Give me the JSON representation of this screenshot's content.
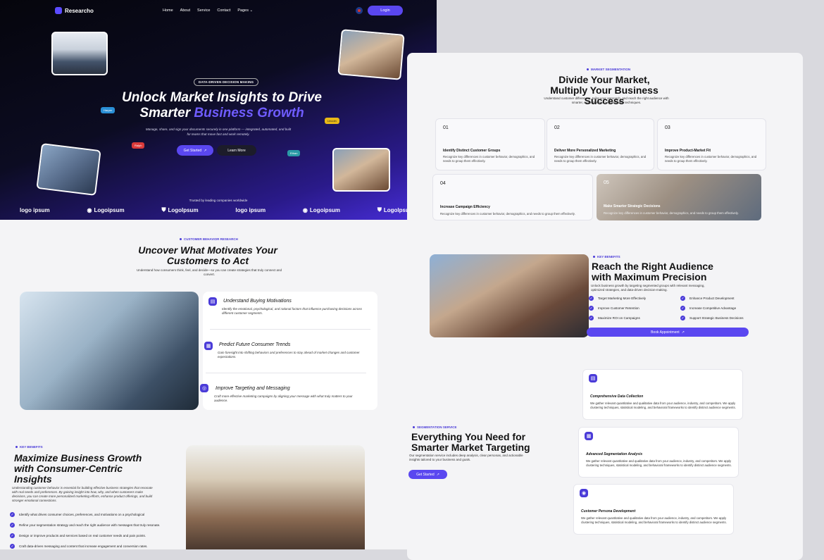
{
  "nav": {
    "brand": "Researcho",
    "links": [
      "Home",
      "About",
      "Service",
      "Contact",
      "Pages"
    ],
    "login": "Login"
  },
  "hero": {
    "pill": "DATA-DRIVEN DECISION MAKING",
    "title_line1": "Unlock Market Insights to Drive",
    "title_line2a": "Smarter ",
    "title_line2b": "Business Growth",
    "subtitle": "Manage, share, and sign your documents securely in one platform — integrated, automated, and built for teams that move fast and work remotely.",
    "btn_primary": "Get Started",
    "btn_secondary": "Learn More",
    "tags": [
      "Harper",
      "Lincoln",
      "Ralph",
      "Ethan"
    ],
    "trusted": "Trusted by leading companies worldwide",
    "logos": [
      "logo ipsum",
      "Logoipsum",
      "Logolpsum",
      "logo ipsum",
      "Logoipsum",
      "Logolpsum"
    ]
  },
  "behavior": {
    "eyebrow": "CUSTOMER BEHAVIOR RESEARCH",
    "title": "Uncover What Motivates Your Customers to Act",
    "subtitle": "Understand how consumers think, feel, and decide—so you can create strategies that truly connect and convert.",
    "items": [
      {
        "title": "Understand Buying Motivations",
        "desc": "Identify the emotional, psychological, and rational factors that influence purchasing decisions across different customer segments."
      },
      {
        "title": "Predict Future Consumer Trends",
        "desc": "Gain foresight into shifting behaviors and preferences to stay ahead of market changes and customer expectations."
      },
      {
        "title": "Improve Targeting and Messaging",
        "desc": "Craft more effective marketing campaigns by aligning your message with what truly matters to your audience."
      }
    ]
  },
  "growth": {
    "eyebrow": "KEY BENEFITS",
    "title": "Maximize Business Growth with Consumer-Centric Insights",
    "desc": "Understanding customer behavior is essential for building effective business strategies that resonate with real needs and preferences. By gaining insight into how, why, and when customers make decisions, you can create more personalized marketing efforts, enhance product offerings, and build stronger emotional connections.",
    "checks": [
      "Identify what drives consumer choices, preferences, and motivations on a psychological",
      "Refine your segmentation strategy and reach the right audience with messages that truly resonate.",
      "Design or improve products and services based on real customer needs and pain points.",
      "Craft data-driven messaging and content that increase engagement and conversion rates."
    ]
  },
  "segmentation": {
    "eyebrow": "MARKET SEGMENTATION",
    "title": "Divide Your Market, Multiply Your Business Success",
    "subtitle": "Understand customer differences, tailor your approach, and reach the right audience with smarter, more strategic segmentation techniques.",
    "cards": [
      {
        "num": "01",
        "title": "Identify Distinct Customer Groups",
        "desc": "Recognize key differences in customer behavior, demographics, and needs to group them effectively."
      },
      {
        "num": "02",
        "title": "Deliver More Personalized Marketing",
        "desc": "Recognize key differences in customer behavior, demographics, and needs to group them effectively."
      },
      {
        "num": "03",
        "title": "Improve Product-Market Fit",
        "desc": "Recognize key differences in customer behavior, demographics, and needs to group them effectively."
      },
      {
        "num": "04",
        "title": "Increase Campaign Efficiency",
        "desc": "Recognize key differences in customer behavior, demographics, and needs to group them effectively."
      },
      {
        "num": "05",
        "title": "Make Smarter Strategic Decisions",
        "desc": "Recognize key differences in customer behavior, demographics, and needs to group them effectively."
      }
    ]
  },
  "audience": {
    "eyebrow": "KEY BENEFITS",
    "title": "Reach the Right Audience with Maximum Precision",
    "desc": "Unlock business growth by targeting segmented groups with relevant messaging, optimized strategies, and data-driven decision-making.",
    "checks": [
      "Target Marketing More Effectively",
      "Enhance Product Development",
      "Improve Customer Retention",
      "Increase Competitive Advantage",
      "Maximize ROI on Campaigns",
      "Support Strategic Business Decisions"
    ],
    "button": "Book Appointment"
  },
  "service": {
    "eyebrow": "SEGMENTATION SERVICE",
    "title": "Everything You Need for Smarter Market Targeting",
    "desc": "Our segmentation service includes deep analysis, clear personas, and actionable insights tailored to your business and goals.",
    "button": "Get Started",
    "cards": [
      {
        "title": "Comprehensive Data Collection",
        "desc": "We gather relevant quantitative and qualitative data from your audience, industry, and competitors. We apply clustering techniques, statistical modeling, and behavioral frameworks to identify distinct audience segments."
      },
      {
        "title": "Advanced Segmentation Analysis",
        "desc": "We gather relevant quantitative and qualitative data from your audience, industry, and competitors. We apply clustering techniques, statistical modeling, and behavioral frameworks to identify distinct audience segments."
      },
      {
        "title": "Customer Persona Development",
        "desc": "We gather relevant quantitative and qualitative data from your audience, industry, and competitors. We apply clustering techniques, statistical modeling, and behavioral frameworks to identify distinct audience segments."
      }
    ]
  },
  "colors": {
    "accent": "#4a3bd8",
    "hero_dark": "#05050c",
    "hero_purple": "#4a2fe0"
  }
}
